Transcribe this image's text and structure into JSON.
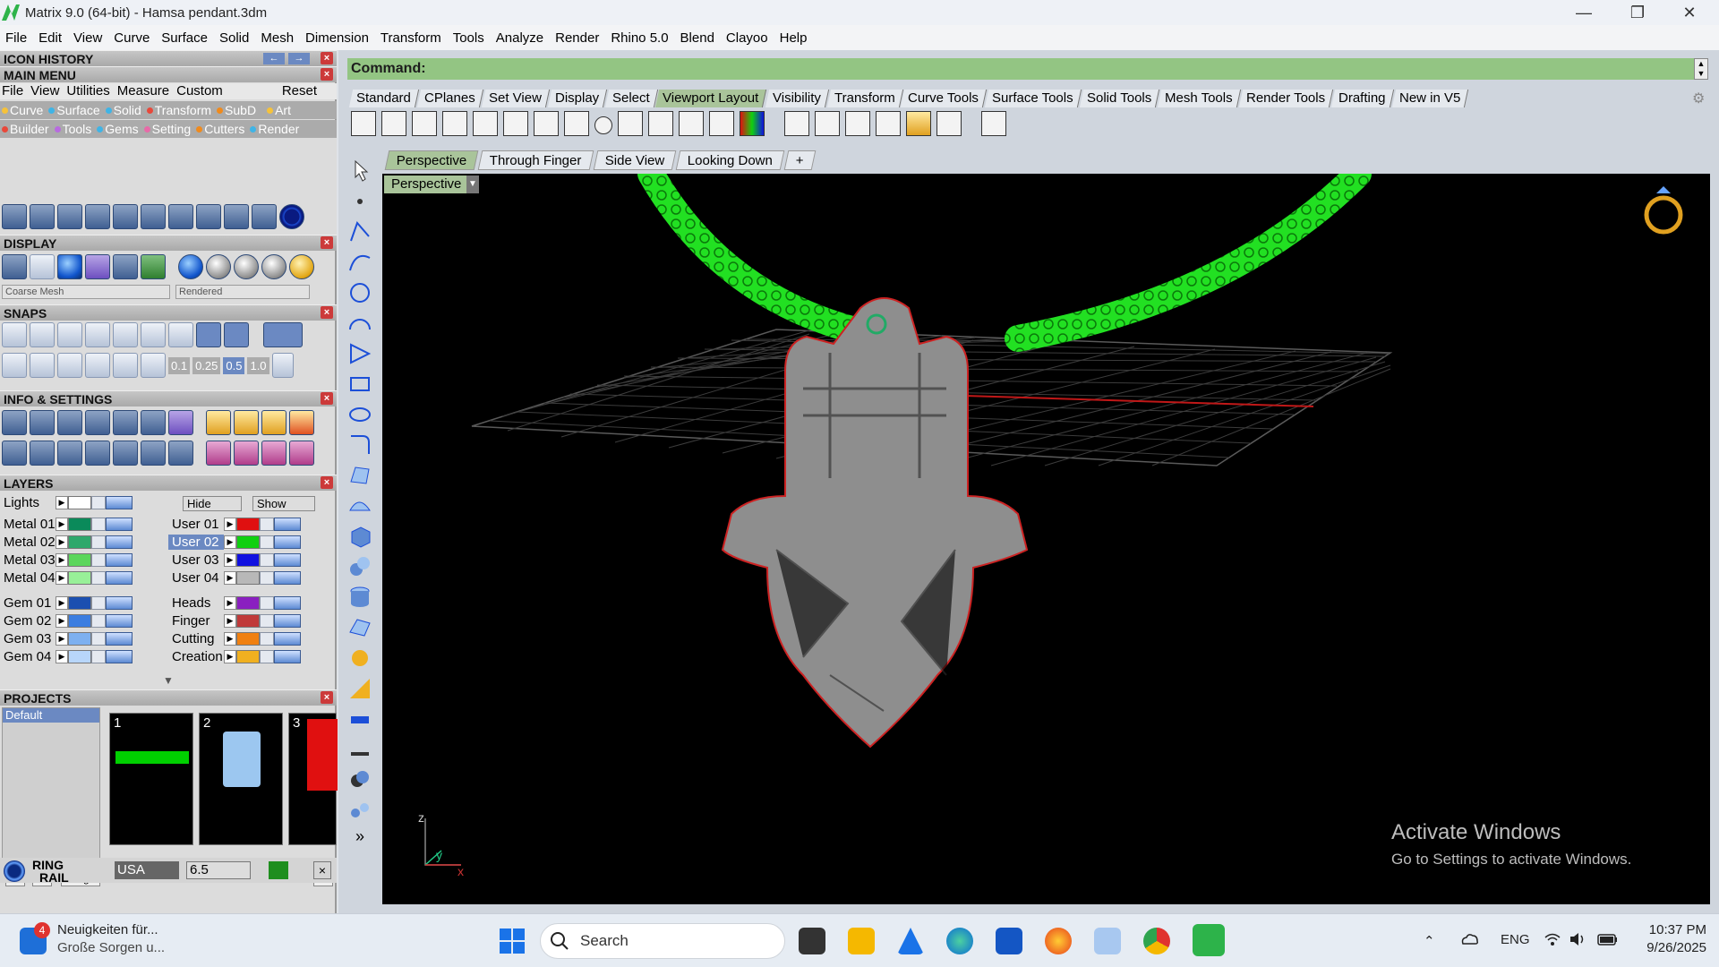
{
  "window": {
    "title": "Matrix 9.0 (64-bit) - Hamsa pendant.3dm",
    "minimize": "—",
    "restore": "❐",
    "close": "✕"
  },
  "menu": [
    "File",
    "Edit",
    "View",
    "Curve",
    "Surface",
    "Solid",
    "Mesh",
    "Dimension",
    "Transform",
    "Tools",
    "Analyze",
    "Render",
    "Rhino 5.0",
    "Blend",
    "Clayoo",
    "Help"
  ],
  "panels": {
    "icon_history": "ICON HISTORY",
    "main_menu": "MAIN MENU",
    "main_menu_items": [
      "File",
      "View",
      "Utilities",
      "Measure",
      "Custom"
    ],
    "reset": "Reset",
    "cats_row1": [
      {
        "label": "Curve",
        "color": "#f6c23a"
      },
      {
        "label": "Surface",
        "color": "#3fb4e6"
      },
      {
        "label": "Solid",
        "color": "#3fb4e6"
      },
      {
        "label": "Transform",
        "color": "#e8483a"
      },
      {
        "label": "SubD",
        "color": "#f08a1c"
      },
      {
        "label": "Art",
        "color": "#f6c23a"
      }
    ],
    "cats_row2": [
      {
        "label": "Builder",
        "color": "#e8483a"
      },
      {
        "label": "Tools",
        "color": "#b86be0"
      },
      {
        "label": "Gems",
        "color": "#3fb4e6"
      },
      {
        "label": "Setting",
        "color": "#e86aa8"
      },
      {
        "label": "Cutters",
        "color": "#f08a1c"
      },
      {
        "label": "Render",
        "color": "#3fb4e6"
      }
    ],
    "display": "DISPLAY",
    "display_mesh": "Coarse Mesh",
    "display_mode": "Rendered",
    "snaps": "SNAPS",
    "snap_values": [
      "0.1",
      "0.25",
      "0.5",
      "1.0"
    ],
    "info": "INFO & SETTINGS",
    "layers": "LAYERS",
    "layers_hide": "Hide",
    "layers_show": "Show",
    "projects": "PROJECTS",
    "project_default": "Default",
    "project_nums": [
      "1",
      "2",
      "3"
    ],
    "mngr": "Mngr",
    "ring_line1": "RING",
    "ring_line2": "RAIL",
    "ring_standard": "USA",
    "ring_size": "6.5"
  },
  "layers_left": [
    {
      "name": "Lights",
      "color": "#ffffff"
    },
    {
      "name": "Metal 01",
      "color": "#0a8a5a"
    },
    {
      "name": "Metal 02",
      "color": "#2ea86b"
    },
    {
      "name": "Metal 03",
      "color": "#5bd65b"
    },
    {
      "name": "Metal 04",
      "color": "#98f098"
    },
    {
      "name": "Gem 01",
      "color": "#1b4fb0"
    },
    {
      "name": "Gem 02",
      "color": "#3b7de0"
    },
    {
      "name": "Gem 03",
      "color": "#7db0f0"
    },
    {
      "name": "Gem 04",
      "color": "#b8d6fa"
    }
  ],
  "layers_right": [
    {
      "name": "User 01",
      "color": "#e01010"
    },
    {
      "name": "User 02",
      "color": "#10d010"
    },
    {
      "name": "User 03",
      "color": "#1010e0"
    },
    {
      "name": "User 04",
      "color": "#b8b8b8"
    },
    {
      "name": "Heads",
      "color": "#8a1fc0"
    },
    {
      "name": "Finger",
      "color": "#c03a3a"
    },
    {
      "name": "Cutting",
      "color": "#f08010"
    },
    {
      "name": "Creation",
      "color": "#f0b020"
    }
  ],
  "command": {
    "label": "Command:"
  },
  "toolbar_tabs": [
    "Standard",
    "CPlanes",
    "Set View",
    "Display",
    "Select",
    "Viewport Layout",
    "Visibility",
    "Transform",
    "Curve Tools",
    "Surface Tools",
    "Solid Tools",
    "Mesh Tools",
    "Render Tools",
    "Drafting",
    "New in V5"
  ],
  "active_toolbar_tab": "Viewport Layout",
  "viewport_tabs": [
    "Perspective",
    "Through Finger",
    "Side View",
    "Looking Down"
  ],
  "viewport_add": "+",
  "viewport_label": "Perspective",
  "axes": {
    "z": "z",
    "y": "y",
    "x": "x"
  },
  "watermark": {
    "line1": "Activate Windows",
    "line2": "Go to Settings to activate Windows."
  },
  "taskbar": {
    "news_badge": "4",
    "news_title": "Neuigkeiten für...",
    "news_sub": "Große Sorgen u...",
    "search": "Search",
    "lang": "ENG",
    "time": "10:37 PM",
    "date": "9/26/2025"
  }
}
